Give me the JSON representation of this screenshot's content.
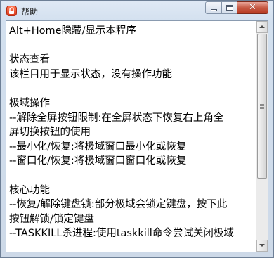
{
  "window": {
    "title": "帮助",
    "close_label": "✕"
  },
  "help": {
    "lines": [
      "Alt+Home隐藏/显示本程序",
      "",
      "状态查看",
      "该栏目用于显示状态，没有操作功能",
      "",
      "极域操作",
      "--解除全屏按钮限制:在全屏状态下恢复右上角全",
      "屏切换按钮的使用",
      "--最小化/恢复:将极域窗口最小化或恢复",
      "--窗口化/恢复:将极域窗口窗口化或恢复",
      "",
      "核心功能",
      "--恢复/解除键盘锁:部分极域会锁定键盘，按下此",
      "按钮解锁/锁定键盘",
      "--TASKKILL杀进程:使用taskkill命令尝试关闭极域"
    ]
  },
  "colors": {
    "titlebar": "#dfe9f5",
    "close_button": "#c75a45",
    "app_icon": "#e64a2a"
  }
}
